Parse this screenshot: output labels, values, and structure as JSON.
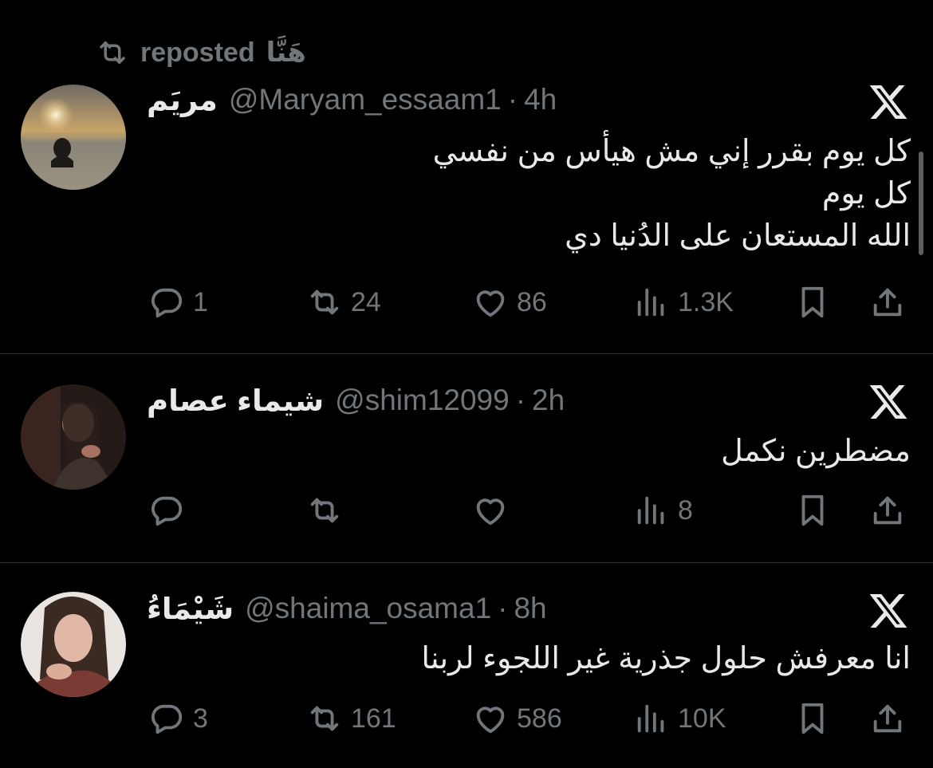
{
  "repost": {
    "by": "هَنَّا",
    "label": "reposted"
  },
  "tweets": [
    {
      "name": "مريَم",
      "handle": "@Maryam_essaam1",
      "time": "4h",
      "lines": [
        "كل يوم بقرر إني  مش هيأس من نفسي",
        "كل يوم",
        "الله المستعان على الدُنيا دي"
      ],
      "replies": "1",
      "reposts": "24",
      "likes": "86",
      "views": "1.3K"
    },
    {
      "name": "شيماء عصام",
      "handle": "@shim12099",
      "time": "2h",
      "lines": [
        "مضطرين نكمل"
      ],
      "replies": "",
      "reposts": "",
      "likes": "",
      "views": "8"
    },
    {
      "name": "شَيْمَاءُ",
      "handle": "@shaima_osama1",
      "time": "8h",
      "lines": [
        "انا معرفش حلول جذرية غير اللجوء لربنا"
      ],
      "replies": "3",
      "reposts": "161",
      "likes": "586",
      "views": "10K"
    }
  ],
  "icons": {
    "repost": "repost-icon",
    "reply": "reply-icon",
    "like": "heart-icon",
    "views": "views-icon",
    "bookmark": "bookmark-icon",
    "share": "share-icon",
    "platform": "x-logo-icon"
  },
  "colors": {
    "background": "#000000",
    "text": "#e7e9ea",
    "muted": "#71767b",
    "divider": "#2f3336"
  }
}
